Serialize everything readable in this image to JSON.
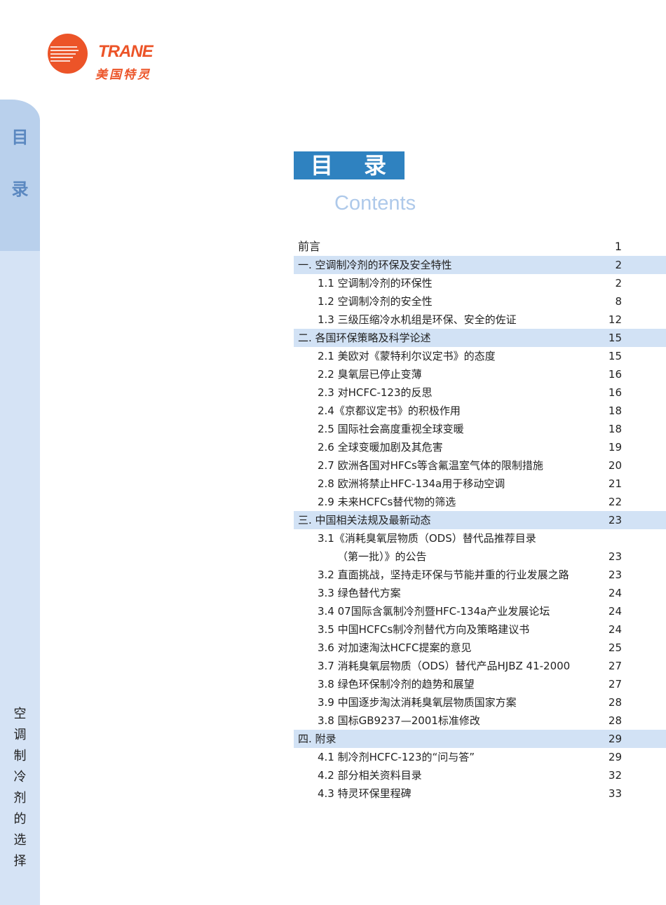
{
  "logo": {
    "brand": "TRANE",
    "cn": "美国特灵"
  },
  "sidebar": {
    "title": [
      "目",
      "录"
    ],
    "vertical": [
      "空",
      "调",
      "制",
      "冷",
      "剂",
      "的",
      "选",
      "择"
    ]
  },
  "heading": {
    "chars": [
      "目",
      "录"
    ],
    "english": "Contents"
  },
  "toc": [
    {
      "type": "top",
      "title": "前言",
      "page": "1"
    },
    {
      "type": "sec",
      "title": "一. 空调制冷剂的环保及安全特性",
      "page": "2"
    },
    {
      "type": "sub",
      "title": "1.1 空调制冷剂的环保性",
      "page": "2"
    },
    {
      "type": "sub",
      "title": "1.2 空调制冷剂的安全性",
      "page": "8"
    },
    {
      "type": "sub",
      "title": "1.3 三级压缩冷水机组是环保、安全的佐证",
      "page": "12"
    },
    {
      "type": "sec",
      "title": "二. 各国环保策略及科学论述",
      "page": "15"
    },
    {
      "type": "sub",
      "title": "2.1 美欧对《蒙特利尔议定书》的态度",
      "page": "15"
    },
    {
      "type": "sub",
      "title": "2.2 臭氧层已停止变薄",
      "page": "16"
    },
    {
      "type": "sub",
      "title": "2.3 对HCFC-123的反思",
      "page": "16"
    },
    {
      "type": "sub",
      "title": "2.4《京都议定书》的积极作用",
      "page": "18"
    },
    {
      "type": "sub",
      "title": "2.5 国际社会高度重视全球变暖",
      "page": "18"
    },
    {
      "type": "sub",
      "title": "2.6 全球变暖加剧及其危害",
      "page": "19"
    },
    {
      "type": "sub",
      "title": "2.7 欧洲各国对HFCs等含氟温室气体的限制措施",
      "page": "20"
    },
    {
      "type": "sub",
      "title": "2.8 欧洲将禁止HFC-134a用于移动空调",
      "page": "21"
    },
    {
      "type": "sub",
      "title": "2.9 未来HCFCs替代物的筛选",
      "page": "22"
    },
    {
      "type": "sec",
      "title": "三. 中国相关法规及最新动态",
      "page": "23"
    },
    {
      "type": "sub",
      "title": "3.1《消耗臭氧层物质（ODS）替代品推荐目录",
      "page": ""
    },
    {
      "type": "cont",
      "title": "（第一批）》的公告",
      "page": "23"
    },
    {
      "type": "sub",
      "title": "3.2 直面挑战，坚持走环保与节能并重的行业发展之路",
      "page": "23"
    },
    {
      "type": "sub",
      "title": "3.3 绿色替代方案",
      "page": "24"
    },
    {
      "type": "sub",
      "title": "3.4 07国际含氯制冷剂暨HFC-134a产业发展论坛",
      "page": "24"
    },
    {
      "type": "sub",
      "title": "3.5 中国HCFCs制冷剂替代方向及策略建议书",
      "page": "24"
    },
    {
      "type": "sub",
      "title": "3.6 对加速淘汰HCFC提案的意见",
      "page": "25"
    },
    {
      "type": "sub",
      "title": "3.7 消耗臭氧层物质（ODS）替代产品HJBZ 41-2000",
      "page": "27"
    },
    {
      "type": "sub",
      "title": "3.8 绿色环保制冷剂的趋势和展望",
      "page": "27"
    },
    {
      "type": "sub",
      "title": "3.9 中国逐步淘汰消耗臭氧层物质国家方案",
      "page": "28"
    },
    {
      "type": "sub",
      "title": "3.8 国标GB9237—2001标准修改",
      "page": "28"
    },
    {
      "type": "sec",
      "title": "四. 附录",
      "page": "29"
    },
    {
      "type": "sub",
      "title": "4.1 制冷剂HCFC-123的“问与答”",
      "page": "29"
    },
    {
      "type": "sub",
      "title": "4.2 部分相关资料目录",
      "page": "32"
    },
    {
      "type": "sub",
      "title": "4.3 特灵环保里程碑",
      "page": "33"
    }
  ]
}
